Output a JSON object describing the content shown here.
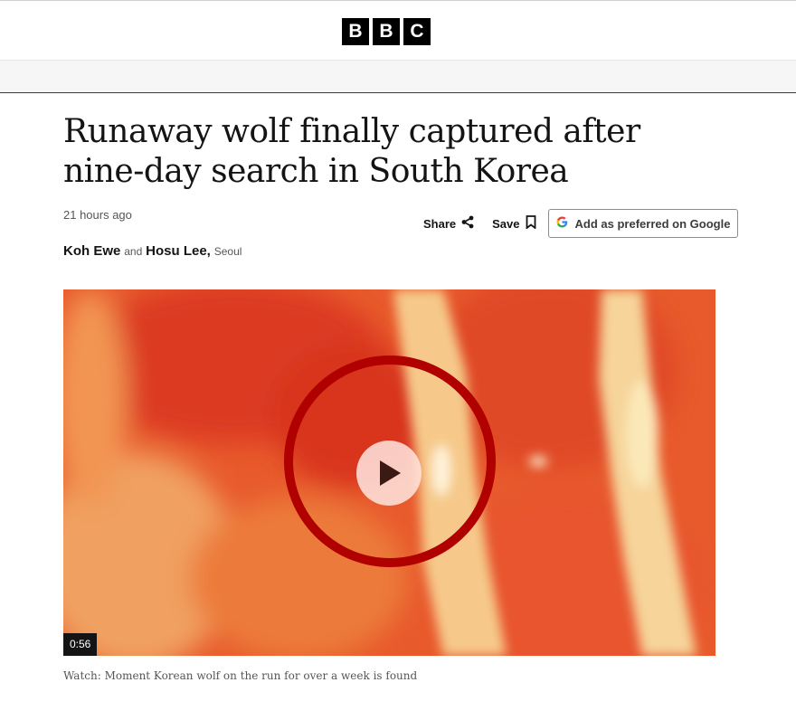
{
  "masthead": {
    "logo_letters": [
      "B",
      "B",
      "C"
    ]
  },
  "article": {
    "headline": "Runaway wolf finally captured after nine-day search in South Korea",
    "timestamp": "21 hours ago",
    "actions": {
      "share_label": "Share",
      "save_label": "Save",
      "google_label": "Add as preferred on Google"
    },
    "byline": {
      "author1": "Koh Ewe",
      "conjunction": "and",
      "author2": "Hosu Lee,",
      "location": "Seoul"
    },
    "video": {
      "duration": "0:56",
      "caption": "Watch: Moment Korean wolf on the run for over a week is found"
    }
  },
  "icons": [
    "share-icon",
    "bookmark-icon",
    "google-icon",
    "play-icon"
  ],
  "colors": {
    "accent_red": "#b00000",
    "text": "#141414",
    "muted": "#545658"
  }
}
